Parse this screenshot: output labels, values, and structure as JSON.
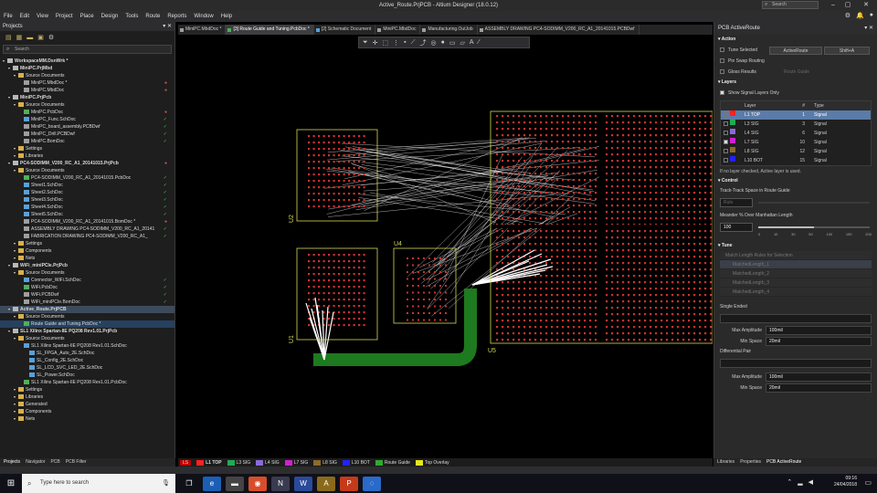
{
  "window": {
    "title": "Active_Route.PrjPCB - Altium Designer (18.0.12)",
    "search_placeholder": "Search"
  },
  "menu": [
    "File",
    "Edit",
    "View",
    "Project",
    "Place",
    "Design",
    "Tools",
    "Route",
    "Reports",
    "Window",
    "Help"
  ],
  "projects_panel": {
    "title": "Projects",
    "search_placeholder": "Search",
    "tree": [
      {
        "label": "WorkspaceMM.DsnWrk *",
        "indent": 0,
        "icon": "proj",
        "status": ""
      },
      {
        "label": "MiniPC.PrjMbd",
        "indent": 1,
        "icon": "proj",
        "status": ""
      },
      {
        "label": "Source Documents",
        "indent": 2,
        "icon": "fold",
        "status": ""
      },
      {
        "label": "MiniPC.MbdDoc *",
        "indent": 3,
        "icon": "doc",
        "status": "err"
      },
      {
        "label": "MiniPC.MbdDoc",
        "indent": 3,
        "icon": "doc",
        "status": "err"
      },
      {
        "label": "MiniPC.PrjPcb",
        "indent": 1,
        "icon": "proj",
        "status": ""
      },
      {
        "label": "Source Documents",
        "indent": 2,
        "icon": "fold",
        "status": ""
      },
      {
        "label": "MiniPC.PcbDoc",
        "indent": 3,
        "icon": "pcb",
        "status": "err"
      },
      {
        "label": "MiniPC_Func.SchDoc",
        "indent": 3,
        "icon": "sch",
        "status": "ok"
      },
      {
        "label": "MiniPC_board_assembly.PCBDwf",
        "indent": 3,
        "icon": "doc",
        "status": "ok"
      },
      {
        "label": "MiniPC_Drill.PCBDwf",
        "indent": 3,
        "icon": "doc",
        "status": "ok"
      },
      {
        "label": "MiniPC.BomDoc",
        "indent": 3,
        "icon": "doc",
        "status": "ok"
      },
      {
        "label": "Settings",
        "indent": 2,
        "icon": "fold",
        "status": ""
      },
      {
        "label": "Libraries",
        "indent": 2,
        "icon": "fold",
        "status": ""
      },
      {
        "label": "PC4-SODIMM_V200_RC_A1_20141015.PrjPcb",
        "indent": 1,
        "icon": "proj",
        "status": "err"
      },
      {
        "label": "Source Documents",
        "indent": 2,
        "icon": "fold",
        "status": ""
      },
      {
        "label": "PC4-SODIMM_V200_RC_A1_20141015.PcbDoc",
        "indent": 3,
        "icon": "pcb",
        "status": "ok"
      },
      {
        "label": "Sheet1.SchDoc",
        "indent": 3,
        "icon": "sch",
        "status": "ok"
      },
      {
        "label": "Sheet2.SchDoc",
        "indent": 3,
        "icon": "sch",
        "status": "ok"
      },
      {
        "label": "Sheet3.SchDoc",
        "indent": 3,
        "icon": "sch",
        "status": "ok"
      },
      {
        "label": "Sheet4.SchDoc",
        "indent": 3,
        "icon": "sch",
        "status": "ok"
      },
      {
        "label": "Sheet5.SchDoc",
        "indent": 3,
        "icon": "sch",
        "status": "ok"
      },
      {
        "label": "PC4-SODIMM_V200_RC_A1_20141015.BomDoc *",
        "indent": 3,
        "icon": "doc",
        "status": "err"
      },
      {
        "label": "ASSEMBLY DRAWING PC4-SODIMM_V200_RC_A1_20141",
        "indent": 3,
        "icon": "doc",
        "status": "ok"
      },
      {
        "label": "FABRICATION DRAWING PC4-SODIMM_V200_RC_A1_",
        "indent": 3,
        "icon": "doc",
        "status": "ok"
      },
      {
        "label": "Settings",
        "indent": 2,
        "icon": "fold",
        "status": ""
      },
      {
        "label": "Components",
        "indent": 2,
        "icon": "fold",
        "status": ""
      },
      {
        "label": "Nets",
        "indent": 2,
        "icon": "fold",
        "status": ""
      },
      {
        "label": "WiFi_miniPCIe.PrjPcb",
        "indent": 1,
        "icon": "proj",
        "status": ""
      },
      {
        "label": "Source Documents",
        "indent": 2,
        "icon": "fold",
        "status": ""
      },
      {
        "label": "Connector_WiFi.SchDoc",
        "indent": 3,
        "icon": "sch",
        "status": "ok"
      },
      {
        "label": "WiFi.PcbDoc",
        "indent": 3,
        "icon": "pcb",
        "status": "ok"
      },
      {
        "label": "WiFi.PCBDwf",
        "indent": 3,
        "icon": "doc",
        "status": "ok"
      },
      {
        "label": "WiFi_miniPCIe.BomDoc",
        "indent": 3,
        "icon": "doc",
        "status": "ok"
      },
      {
        "label": "Active_Route.PrjPCB",
        "indent": 1,
        "icon": "proj",
        "status": "",
        "selected": true
      },
      {
        "label": "Source Documents",
        "indent": 2,
        "icon": "fold",
        "status": ""
      },
      {
        "label": "Route Guide and Tuning.PcbDoc *",
        "indent": 3,
        "icon": "pcb",
        "status": "",
        "highlight": true
      },
      {
        "label": "SL1 Xilinx Spartan-IIE PQ208 Rev1.01.PrjPcb",
        "indent": 1,
        "icon": "proj",
        "status": ""
      },
      {
        "label": "Source Documents",
        "indent": 2,
        "icon": "fold",
        "status": ""
      },
      {
        "label": "SL1 Xilinx Spartan-IIE PQ208 Rev1.01.SchDoc",
        "indent": 3,
        "icon": "sch",
        "status": ""
      },
      {
        "label": "SL_FPGA_Auto_2E.SchDoc",
        "indent": 4,
        "icon": "sch",
        "status": ""
      },
      {
        "label": "SL_Config_2E.SchDoc",
        "indent": 4,
        "icon": "sch",
        "status": ""
      },
      {
        "label": "SL_LCD_SVC_LED_2E.SchDoc",
        "indent": 4,
        "icon": "sch",
        "status": ""
      },
      {
        "label": "SL_Power.SchDoc",
        "indent": 4,
        "icon": "sch",
        "status": ""
      },
      {
        "label": "SL1 Xilinx Spartan-IIE PQ208 Rev1.01.PcbDoc",
        "indent": 3,
        "icon": "pcb",
        "status": ""
      },
      {
        "label": "Settings",
        "indent": 2,
        "icon": "fold",
        "status": ""
      },
      {
        "label": "Libraries",
        "indent": 2,
        "icon": "fold",
        "status": ""
      },
      {
        "label": "Generated",
        "indent": 2,
        "icon": "fold",
        "status": ""
      },
      {
        "label": "Components",
        "indent": 2,
        "icon": "fold",
        "status": ""
      },
      {
        "label": "Nets",
        "indent": 2,
        "icon": "fold",
        "status": ""
      }
    ],
    "bottom_tabs": [
      "Projects",
      "Navigator",
      "PCB",
      "PCB Filter"
    ]
  },
  "doc_tabs": [
    {
      "label": "MiniPC.MbdDoc *",
      "color": "#9e9e9e"
    },
    {
      "label": "[3] Route Guide and Tuning.PcbDoc *",
      "color": "#4fb05a",
      "active": true
    },
    {
      "label": "[2] Schematic Document",
      "color": "#5aa0d8"
    },
    {
      "label": "MiniPC.MbdDoc",
      "color": "#9e9e9e"
    },
    {
      "label": "Manufacturing.OutJob",
      "color": "#9e9e9e"
    },
    {
      "label": "ASSEMBLY DRAWING PC4-SODIMM_V200_RC_A1_20141015.PCBDwf",
      "color": "#9e9e9e"
    }
  ],
  "board": {
    "designators": {
      "u2": "U2",
      "u1": "U1",
      "u4": "U4",
      "u5": "U5"
    },
    "colors": {
      "pad": "#c83232",
      "outline": "#d8d850",
      "route_guide": "#1e7a1e",
      "ratsnest": "#e6e6e6",
      "top_layer": "#ff2020"
    }
  },
  "layer_tabs": [
    {
      "label": "LS",
      "color": "#c00000"
    },
    {
      "label": "L1 TOP",
      "color": "#ff2020"
    },
    {
      "label": "L3 SIG",
      "color": "#22aa55"
    },
    {
      "label": "L4 SIG",
      "color": "#8a6ad8"
    },
    {
      "label": "L7 SIG",
      "color": "#d020d0"
    },
    {
      "label": "L8 SIG",
      "color": "#8b6a2a"
    },
    {
      "label": "L10 BOT",
      "color": "#2222ff"
    },
    {
      "label": "Route Guide",
      "color": "#2eaa2e"
    },
    {
      "label": "Top Overlay",
      "color": "#e6e620"
    }
  ],
  "right_panel": {
    "title": "PCB ActiveRoute",
    "action": {
      "heading": "Action",
      "tune_selected": "Tune Selected",
      "activeroute_btn": "ActiveRoute",
      "shortcut": "Shift+A",
      "pin_swap": "Pin Swap Routing",
      "gloss": "Gloss Results",
      "route_guide": "Route Guide"
    },
    "layers": {
      "heading": "Layers",
      "show_signal": "Show Signal Layers Only",
      "col_layer": "Layer",
      "col_num": "#",
      "col_type": "Type",
      "rows": [
        {
          "name": "L1 TOP",
          "num": "1",
          "type": "Signal",
          "color": "#ff2020",
          "checked": false,
          "selected": true
        },
        {
          "name": "L3 SIG",
          "num": "3",
          "type": "Signal",
          "color": "#22aa55",
          "checked": false
        },
        {
          "name": "L4 SIG",
          "num": "6",
          "type": "Signal",
          "color": "#8a6ad8",
          "checked": false
        },
        {
          "name": "L7 SIG",
          "num": "10",
          "type": "Signal",
          "color": "#d020d0",
          "checked": true
        },
        {
          "name": "L8 SIG",
          "num": "12",
          "type": "Signal",
          "color": "#8b6a2a",
          "checked": false
        },
        {
          "name": "L10 BOT",
          "num": "15",
          "type": "Signal",
          "color": "#2222ff",
          "checked": false
        }
      ],
      "note": "If no layer checked, Active layer is used."
    },
    "control": {
      "heading": "Control",
      "track_label": "Track-Track Space in Route Guide",
      "track_value": "Rule",
      "meander_label": "Meander % Over Manhattan Length",
      "meander_value": "100",
      "meander_fraction": 0.5,
      "meander_ticks": [
        "0",
        "10",
        "30",
        "50",
        "100",
        "150",
        "200"
      ]
    },
    "tune": {
      "heading": "Tune",
      "items": [
        "Match Length Rules for Selection",
        "MatchedLength_1",
        "MatchedLength_2",
        "MatchedLength_3",
        "MatchedLength_4"
      ]
    },
    "single_ended": {
      "heading": "Single Ended",
      "max_amp_label": "Max Amplitude",
      "max_amp": "100mil",
      "min_space_label": "Min Space",
      "min_space": "20mil"
    },
    "diff_pair": {
      "heading": "Differential Pair",
      "max_amp_label": "Max Amplitude",
      "max_amp": "100mil",
      "min_space_label": "Min Space",
      "min_space": "20mil"
    },
    "bottom_tabs": [
      "Libraries",
      "Properties",
      "PCB ActiveRoute"
    ]
  },
  "taskbar": {
    "search_placeholder": "Type here to search",
    "time": "09:16",
    "date": "24/04/2018"
  }
}
